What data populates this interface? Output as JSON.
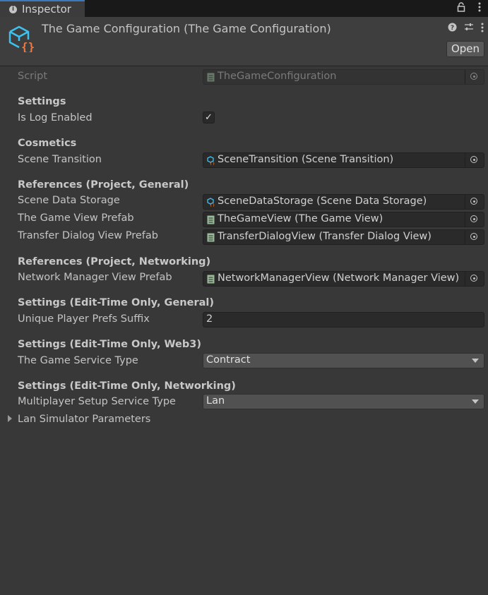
{
  "tab": {
    "label": "Inspector",
    "info_icon": "info-icon"
  },
  "toolbar_icons": [
    "lock-icon",
    "kebab-menu-icon"
  ],
  "header": {
    "title": "The Game Configuration (The Game Configuration)",
    "open_label": "Open",
    "icons": [
      "help-icon",
      "presets-icon",
      "kebab-menu-icon"
    ]
  },
  "script": {
    "label": "Script",
    "value": "TheGameConfiguration"
  },
  "settings": {
    "heading": "Settings",
    "log": {
      "label": "Is Log Enabled",
      "checked": true,
      "checkmark": "✓"
    }
  },
  "cosmetics": {
    "heading": "Cosmetics",
    "scene_transition": {
      "label": "Scene Transition",
      "value": "SceneTransition (Scene Transition)"
    }
  },
  "refs_general": {
    "heading": "References (Project, General)",
    "scene_data_storage": {
      "label": "Scene Data Storage",
      "value": "SceneDataStorage (Scene Data Storage)"
    },
    "game_view_prefab": {
      "label": "The Game View Prefab",
      "value": "TheGameView (The Game View)"
    },
    "transfer_dialog_prefab": {
      "label": "Transfer Dialog View Prefab",
      "value": "TransferDialogView (Transfer Dialog View)"
    }
  },
  "refs_networking": {
    "heading": "References (Project, Networking)",
    "network_manager_prefab": {
      "label": "Network Manager View Prefab",
      "value": "NetworkManagerView (Network Manager View)"
    }
  },
  "edit_general": {
    "heading": "Settings (Edit-Time Only, General)",
    "prefs_suffix": {
      "label": "Unique Player Prefs Suffix",
      "value": "2"
    }
  },
  "edit_web3": {
    "heading": "Settings (Edit-Time Only, Web3)",
    "service_type": {
      "label": "The Game Service Type",
      "value": "Contract"
    }
  },
  "edit_networking": {
    "heading": "Settings (Edit-Time Only, Networking)",
    "multiplayer_type": {
      "label": "Multiplayer Setup Service Type",
      "value": "Lan"
    }
  },
  "foldout": {
    "label": "Lan Simulator Parameters",
    "expanded": false
  },
  "colors": {
    "background": "#383838",
    "tab_accent": "#3a79bb",
    "icon_cyan": "#3ec1f0",
    "icon_orange": "#f07a3e"
  }
}
